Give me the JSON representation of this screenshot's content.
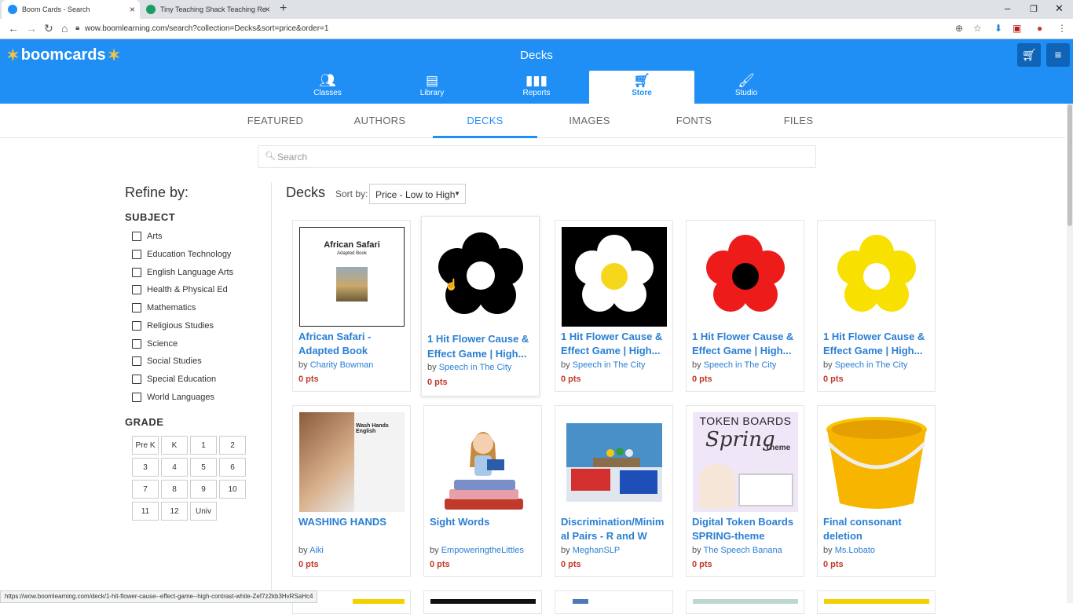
{
  "browser": {
    "tabs": [
      {
        "title": "Boom Cards - Search"
      },
      {
        "title": "Tiny Teaching Shack Teaching Re"
      }
    ],
    "url": "wow.boomlearning.com/search?collection=Decks&sort=price&order=1",
    "status_url": "https://wow.boomlearning.com/deck/1-hit-flower-cause--effect-game--high-contrast-white-Zef7z2kb3HvRSaHc4"
  },
  "app": {
    "logo": "boomcards",
    "title": "Decks",
    "nav": [
      {
        "label": "Classes",
        "icon": "classes-icon"
      },
      {
        "label": "Library",
        "icon": "library-icon"
      },
      {
        "label": "Reports",
        "icon": "reports-icon"
      },
      {
        "label": "Store",
        "icon": "store-icon",
        "active": true
      },
      {
        "label": "Studio",
        "icon": "studio-icon"
      }
    ],
    "collections": [
      "FEATURED",
      "AUTHORS",
      "DECKS",
      "IMAGES",
      "FONTS",
      "FILES"
    ],
    "active_collection": "DECKS",
    "search_placeholder": "Search"
  },
  "sidebar": {
    "refine_label": "Refine by:",
    "subject_label": "SUBJECT",
    "subjects": [
      "Arts",
      "Education Technology",
      "English Language Arts",
      "Health & Physical Ed",
      "Mathematics",
      "Religious Studies",
      "Science",
      "Social Studies",
      "Special Education",
      "World Languages"
    ],
    "grade_label": "GRADE",
    "grades": [
      "Pre K",
      "K",
      "1",
      "2",
      "3",
      "4",
      "5",
      "6",
      "7",
      "8",
      "9",
      "10",
      "11",
      "12",
      "Univ"
    ]
  },
  "results": {
    "heading": "Decks",
    "sort_label": "Sort by:",
    "sort_value": "Price - Low to High",
    "decks": [
      {
        "title_lines": [
          "African Safari -",
          "Adapted Book"
        ],
        "by": "by",
        "author": "Charity Bowman",
        "pts": "0 pts",
        "thumb_text": "African Safari",
        "thumb_sub": "Adapted Book"
      },
      {
        "title_lines": [
          "1 Hit Flower Cause &",
          "Effect Game | High..."
        ],
        "by": "by",
        "author": "Speech in The City",
        "pts": "0 pts"
      },
      {
        "title_lines": [
          "1 Hit Flower Cause &",
          "Effect Game | High..."
        ],
        "by": "by",
        "author": "Speech in The City",
        "pts": "0 pts"
      },
      {
        "title_lines": [
          "1 Hit Flower Cause &",
          "Effect Game | High..."
        ],
        "by": "by",
        "author": "Speech in The City",
        "pts": "0 pts"
      },
      {
        "title_lines": [
          "1 Hit Flower Cause &",
          "Effect Game | High..."
        ],
        "by": "by",
        "author": "Speech in The City",
        "pts": "0 pts"
      },
      {
        "title_lines": [
          "WASHING HANDS",
          ""
        ],
        "by": "by",
        "author": "Aiki",
        "pts": "0 pts",
        "thumb_text": "Wash Hands English"
      },
      {
        "title_lines": [
          "Sight Words",
          ""
        ],
        "by": "by",
        "author": "EmpoweringtheLittles",
        "pts": "0 pts"
      },
      {
        "title_lines": [
          "Discrimination/Minim",
          "al Pairs - R and W"
        ],
        "by": "by",
        "author": "MeghanSLP",
        "pts": "0 pts"
      },
      {
        "title_lines": [
          "Digital Token Boards",
          "SPRING-theme"
        ],
        "by": "by",
        "author": "The Speech Banana",
        "pts": "0 pts",
        "thumb_text": "TOKEN BOARDS",
        "thumb_sub": "Spring",
        "thumb_sub2": "Theme"
      },
      {
        "title_lines": [
          "Final consonant",
          "deletion"
        ],
        "by": "by",
        "author": "Ms.Lobato",
        "pts": "0 pts"
      }
    ]
  },
  "colors": {
    "brand_blue": "#1f8ff6",
    "link_blue": "#2a7fd4",
    "pts_red": "#c0392b"
  }
}
